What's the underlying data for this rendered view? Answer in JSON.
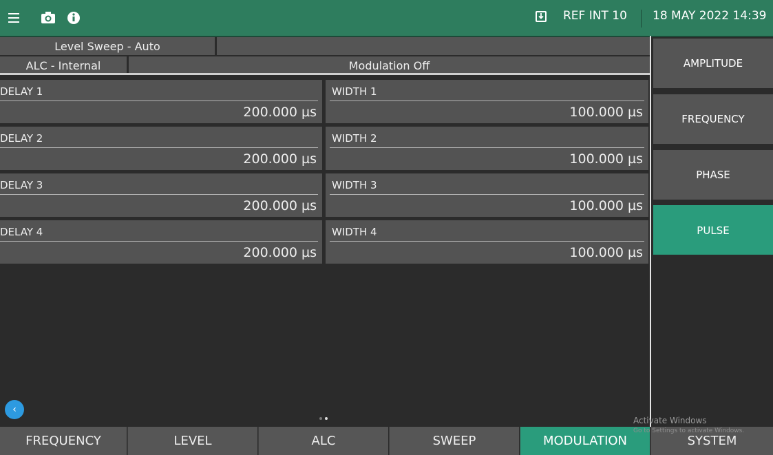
{
  "topbar": {
    "ref_label": "REF INT 10",
    "datetime": "18 MAY 2022 14:39",
    "icons": [
      "menu-icon",
      "camera-icon",
      "info-icon",
      "reference-download-icon"
    ],
    "color": "#2e7d5e"
  },
  "status": {
    "level_sweep": "Level Sweep - Auto",
    "alc": "ALC - Internal",
    "modulation": "Modulation Off"
  },
  "pulse": {
    "fields": [
      {
        "delay_label": "DELAY 1",
        "delay_value": "200.000 µs",
        "width_label": "WIDTH 1",
        "width_value": "100.000 µs"
      },
      {
        "delay_label": "DELAY 2",
        "delay_value": "200.000 µs",
        "width_label": "WIDTH 2",
        "width_value": "100.000 µs"
      },
      {
        "delay_label": "DELAY 3",
        "delay_value": "200.000 µs",
        "width_label": "WIDTH 3",
        "width_value": "100.000 µs"
      },
      {
        "delay_label": "DELAY 4",
        "delay_value": "200.000 µs",
        "width_label": "WIDTH 4",
        "width_value": "100.000 µs"
      }
    ]
  },
  "side_menu": {
    "items": [
      "AMPLITUDE",
      "FREQUENCY",
      "PHASE",
      "PULSE"
    ],
    "active": "PULSE",
    "active_color": "#2a9c7c"
  },
  "bottom_nav": {
    "tabs": [
      "FREQUENCY",
      "LEVEL",
      "ALC",
      "SWEEP",
      "MODULATION",
      "SYSTEM"
    ],
    "active": "MODULATION"
  },
  "back_icon": "chevron-left-icon",
  "watermark": {
    "line1": "Activate Windows",
    "line2": "Go to Settings to activate Windows."
  }
}
